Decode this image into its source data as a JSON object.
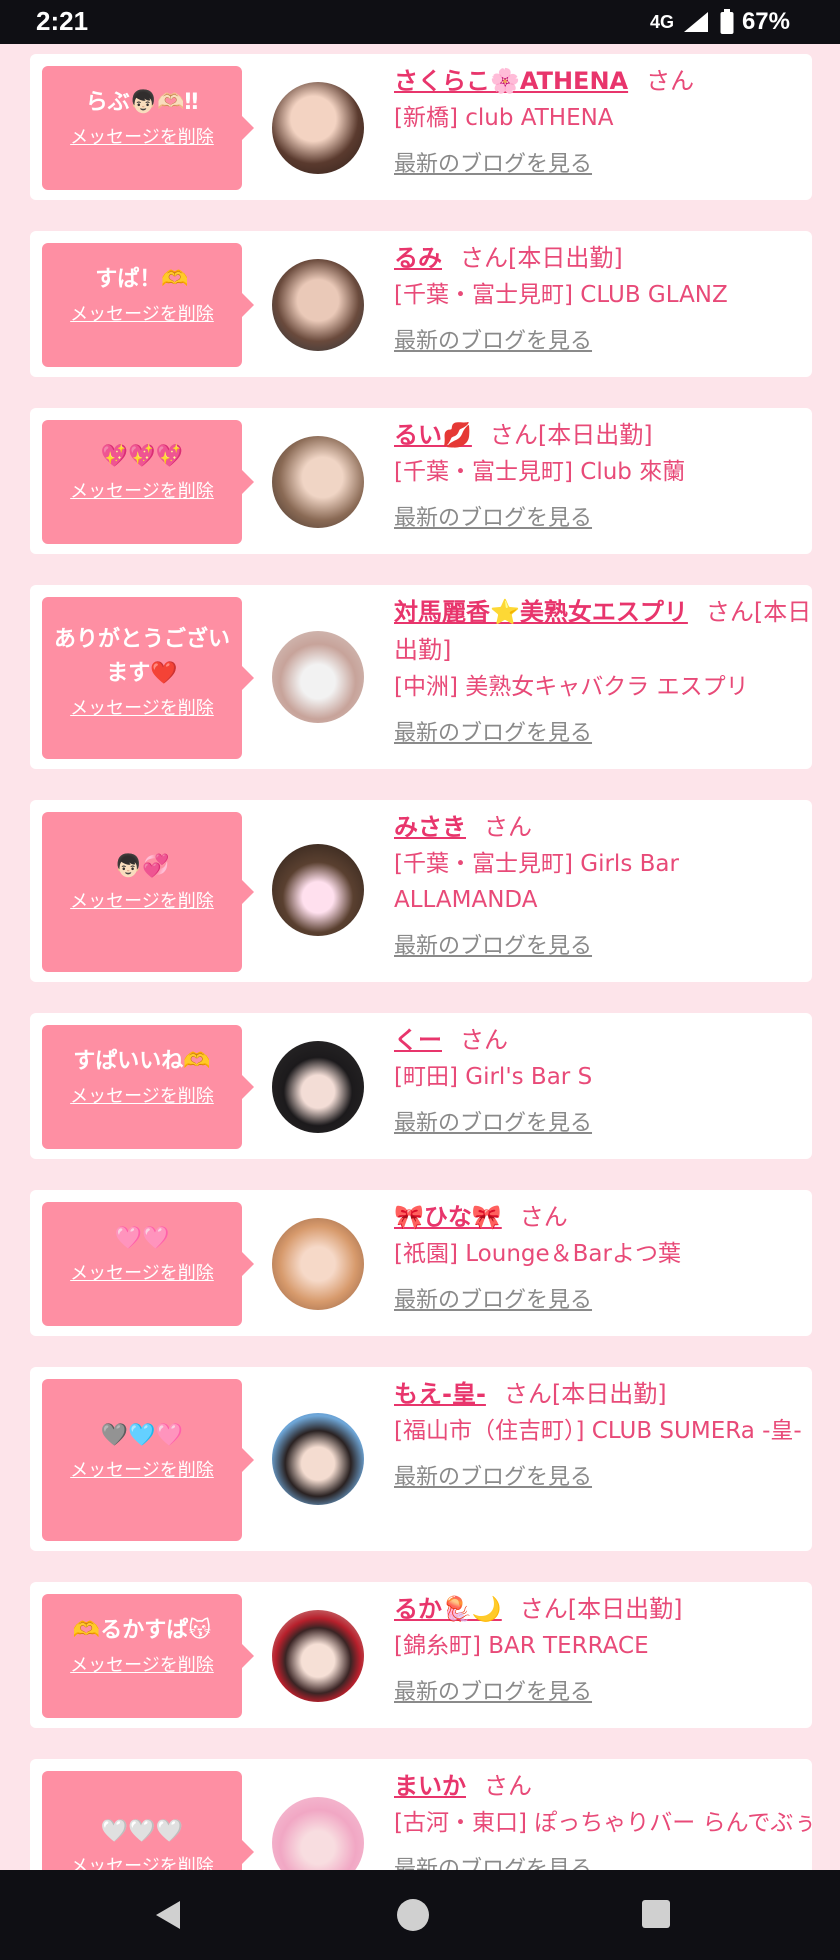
{
  "status_bar": {
    "time": "2:21",
    "network": "4G",
    "battery": "67%"
  },
  "common": {
    "delete_label": "メッセージを削除",
    "blog_label": "最新のブログを見る",
    "san": "さん"
  },
  "cards": [
    {
      "message": "らぶ👦🏻🫶🏻‼",
      "name": "さくらこ🌸ATHENA",
      "suffix": "さん",
      "shop": "[新橋] club ATHENA"
    },
    {
      "message": "すぱ！🫶",
      "name": "るみ",
      "suffix": "さん[本日出勤]",
      "shop": "[千葉・富士見町] CLUB GLANZ"
    },
    {
      "message": "💖💖💖",
      "name": "るい💋",
      "suffix": "さん[本日出勤]",
      "shop": "[千葉・富士見町] Club 來蘭"
    },
    {
      "message": "ありがとうございます❤️",
      "name": "対馬麗香⭐美熟女エスプリ",
      "suffix": "さん[本日出勤]",
      "shop": "[中洲] 美熟女キャバクラ エスプリ"
    },
    {
      "message": "👦🏻💞",
      "name": "みさき",
      "suffix": "さん",
      "shop": "[千葉・富士見町] Girls Bar ALLAMANDA"
    },
    {
      "message": "すぱいいね🫶",
      "name": "くー",
      "suffix": "さん",
      "shop": "[町田] Girl's Bar S"
    },
    {
      "message": "🩷🩷",
      "name": "🎀ひな🎀",
      "suffix": "さん",
      "shop": "[祇園] Lounge＆Barよつ葉"
    },
    {
      "message": "🩶🩵🩷",
      "name": "もえ-皇-",
      "suffix": "さん[本日出勤]",
      "shop": "[福山市（住吉町）] CLUB SUMERa -皇-"
    },
    {
      "message": "🫶るかすぱ😽",
      "name": "るか🪼🌙",
      "suffix": "さん[本日出勤]",
      "shop": "[錦糸町] BAR TERRACE"
    },
    {
      "message": "🤍🤍🤍",
      "name": "まいか",
      "suffix": "さん",
      "shop": "[古河・東口] ぽっちゃりバー らんでぶぅ"
    }
  ],
  "colors": {
    "accent": "#e8356c",
    "bubble": "#fe8fa3",
    "background": "#fde4ea"
  },
  "nav_icons": [
    "back-icon",
    "home-icon",
    "recents-icon"
  ]
}
